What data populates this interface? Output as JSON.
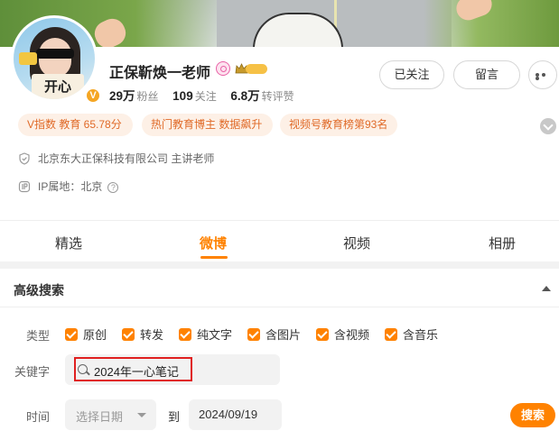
{
  "profile": {
    "name": "正保靳焕一老师",
    "avatar_sign_text": "开心",
    "verified_badge": "V",
    "stats": [
      {
        "value": "29万",
        "label": "粉丝"
      },
      {
        "value": "109",
        "label": "关注"
      },
      {
        "value": "6.8万",
        "label": "转评赞"
      }
    ],
    "actions": {
      "follow_label": "已关注",
      "message_label": "留言"
    },
    "tags": [
      "V指数 教育 65.78分",
      "热门教育博主 数据飙升",
      "视频号教育榜第93名"
    ],
    "company": "北京东大正保科技有限公司 主讲老师",
    "ip_location": "IP属地：北京",
    "help_icon_text": "?"
  },
  "tabs": [
    {
      "label": "精选",
      "active": false
    },
    {
      "label": "微博",
      "active": true
    },
    {
      "label": "视频",
      "active": false
    },
    {
      "label": "相册",
      "active": false
    }
  ],
  "advanced_search": {
    "title": "高级搜索",
    "type_label": "类型",
    "types": [
      "原创",
      "转发",
      "纯文字",
      "含图片",
      "含视频",
      "含音乐"
    ],
    "keyword_label": "关键字",
    "keyword_value": "2024年一心笔记",
    "time_label": "时间",
    "start_date_placeholder": "选择日期",
    "to_label": "到",
    "end_date_value": "2024/09/19",
    "search_button_label": "搜索"
  },
  "colors": {
    "accent": "#ff8200",
    "tag_bg": "#fdf0e6",
    "tag_text": "#e06a28",
    "highlight_border": "#e02020"
  },
  "icons": {
    "verified": "verified-v-icon",
    "pink_badge": "pink-badge-icon",
    "crown": "crown-level-icon",
    "more": "more-dots-icon",
    "expand": "chevron-down-icon",
    "company": "shield-icon",
    "ip": "ip-location-icon",
    "search": "search-icon"
  }
}
